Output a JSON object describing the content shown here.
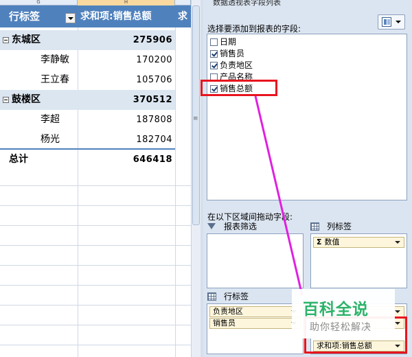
{
  "sheet": {
    "columns": [
      {
        "label": "G",
        "selected": false
      },
      {
        "label": "H",
        "selected": true
      },
      {
        "label": "",
        "selected": false
      }
    ],
    "pivot_header": {
      "row_label": "行标签",
      "value_label": "求和项:销售总额",
      "next_label": "求"
    },
    "rows": [
      {
        "type": "region",
        "label": "东城区",
        "value": "275906"
      },
      {
        "type": "person",
        "label": "李静敏",
        "value": "170200"
      },
      {
        "type": "person",
        "label": "王立春",
        "value": "105706"
      },
      {
        "type": "region",
        "label": "鼓楼区",
        "value": "370512"
      },
      {
        "type": "person",
        "label": "李超",
        "value": "187808"
      },
      {
        "type": "person",
        "label": "杨光",
        "value": "182704"
      }
    ],
    "total": {
      "label": "总计",
      "value": "646418"
    }
  },
  "field_pane": {
    "title": "数据透视表字段列表",
    "choose_label": "选择要添加到报表的字段:",
    "fields": [
      {
        "label": "日期",
        "checked": false
      },
      {
        "label": "销售员",
        "checked": true
      },
      {
        "label": "负责地区",
        "checked": true
      },
      {
        "label": "产品名称",
        "checked": false
      },
      {
        "label": "销售总额",
        "checked": true
      }
    ],
    "drag_label": "在以下区域间拖动字段:",
    "areas": {
      "report_filter": {
        "title": "报表筛选",
        "items": []
      },
      "column_labels": {
        "title": "列标签",
        "items": [
          "数值"
        ]
      },
      "row_labels": {
        "title": "行标签",
        "items": [
          "负责地区",
          "销售员"
        ]
      },
      "values": {
        "title": "",
        "items": [
          "求和项:销售总额"
        ]
      }
    }
  },
  "watermark": {
    "title": "百科全说",
    "subtitle": "助你轻松解决"
  },
  "colors": {
    "pivot_header": "#4f81bd",
    "region_row": "#dce6f1",
    "pane_bg": "#dbe5f1",
    "highlight_box": "#e8141e",
    "annotation_line": "#e020e0",
    "watermark_green": "#2db36a"
  }
}
